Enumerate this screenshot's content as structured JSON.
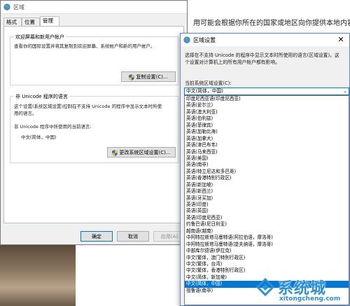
{
  "background": {
    "text": "用可能会根据你所在的国家或地区向你提供本地内容"
  },
  "region_window": {
    "title": "区域",
    "tabs": [
      "格式",
      "位置",
      "管理"
    ],
    "active_tab": 2,
    "welcome_group": {
      "title": "欢迎屏幕和新用户帐户",
      "text": "查看你的国际设置并将其复制到欢迎屏幕、系统帐户和新的用户帐户。",
      "button": "复制设置(C)..."
    },
    "unicode_group": {
      "title": "非 Unicode 程序的语言",
      "text_line1": "这个设置(系统区域设置)控制在不支持 Unicode 的程序中显示文本时所使",
      "text_line2": "用的语言。",
      "current_label": "非 Unicode 程序中所使用的当前语言:",
      "current_value": "中文(简体，中国)",
      "button": "更改系统区域设置(C)..."
    },
    "buttons": {
      "ok": "确定",
      "cancel": "取消",
      "apply": "应用(A)"
    }
  },
  "settings_window": {
    "title": "区域设置",
    "close_glyph": "✕",
    "desc_line1": "选择在不支持 Unicode 的程序中显示文本时所使用的语言(区域设置)。这",
    "desc_line2": "个设置对计算机上的所有用户帐户都有影响。",
    "current_label": "当前系统区域设置(C):",
    "selected_value": "中文(简体，中国)",
    "list": [
      "印度尼西亚语(印度尼西亚)",
      "英语(爱尔兰)",
      "英语(澳大利亚)",
      "英语(伯利兹)",
      "英语(菲律宾)",
      "英语(加勒比海)",
      "英语(加拿大)",
      "英语(津巴布韦)",
      "英语(马来西亚)",
      "英语(美国)",
      "英语(南非)",
      "英语(特立尼达和多巴哥)",
      "英语(香港特别行政区)",
      "英语(新加坡)",
      "英语(新西兰)",
      "英语(牙买加)",
      "英语(印度)",
      "英语(英国)",
      "英语(印度尼西亚)",
      "约鲁巴语(尼日利亚)",
      "越南语(越南)",
      "中阿特拉斯塔马塞特语(阿拉伯语，摩洛哥)",
      "中阿特拉斯塔马塞特语(提夫纳语，摩洛哥)",
      "中部库尔德语(伊拉克)",
      "中文(繁体，澳门特别行政区)",
      "中文(繁体，台湾)",
      "中文(繁体，香港特别行政区)",
      "中文(简体，新加坡)",
      "中文(简体，中国)",
      "祖鲁语(南非)"
    ],
    "selected_index": 28
  },
  "watermark": {
    "cn": "系统城",
    "en": "xitongcheng.com"
  },
  "colors": {
    "accent": "#0078d7",
    "watermark": "#2d8fd5"
  }
}
